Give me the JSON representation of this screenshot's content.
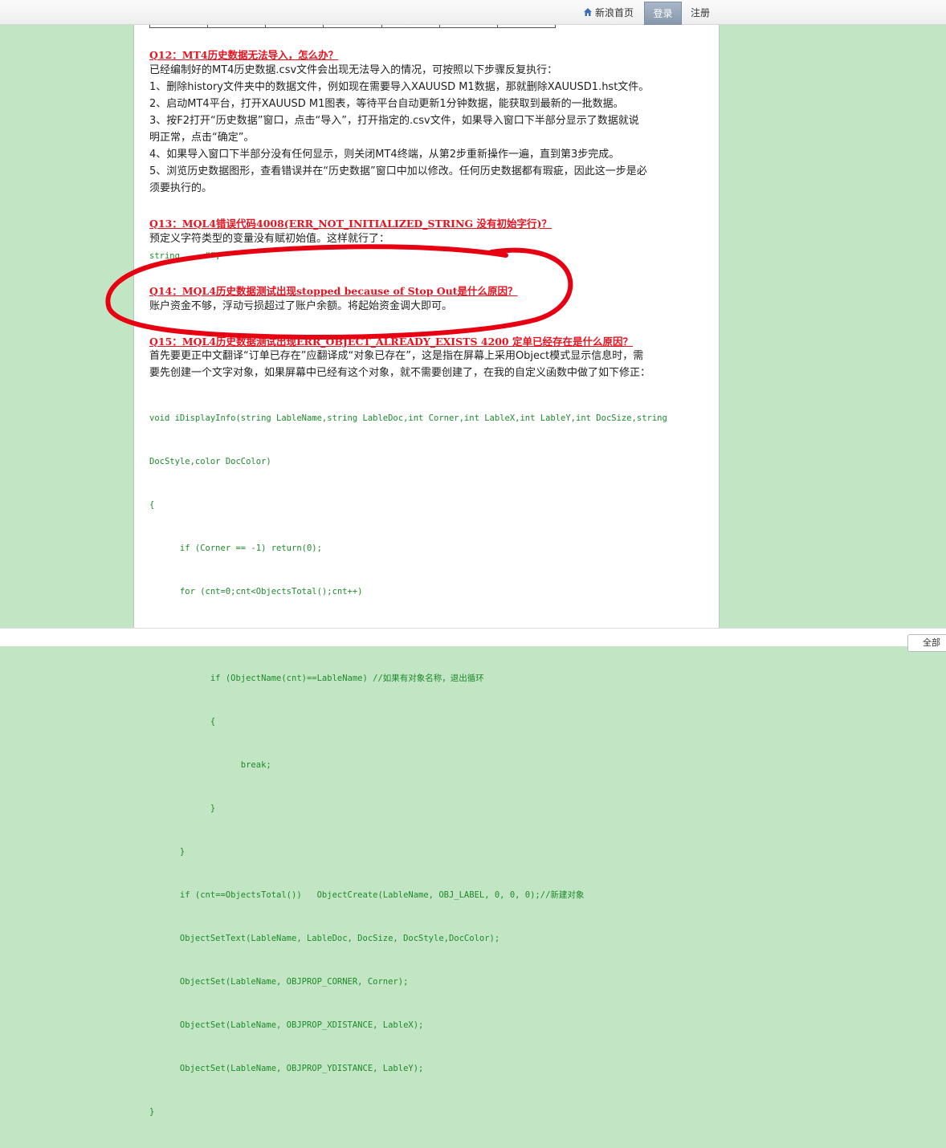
{
  "topbar": {
    "home_label": "新浪首页",
    "login_label": "登录",
    "register_label": "注册"
  },
  "q12": {
    "title": "Q12：MT4历史数据无法导入，怎么办？",
    "lines": [
      "已经编制好的MT4历史数据.csv文件会出现无法导入的情况，可按照以下步骤反复执行：",
      "1、删除history文件夹中的数据文件，例如现在需要导入XAUUSD M1数据，那就删除XAUUSD1.hst文件。",
      "2、启动MT4平台，打开XAUUSD M1图表，等待平台自动更新1分钟数据，能获取到最新的一批数据。",
      "3、按F2打开“历史数据”窗口，点击“导入”，打开指定的.csv文件，如果导入窗口下半部分显示了数据就说",
      "明正常，点击“确定”。",
      "4、如果导入窗口下半部分没有任何显示，则关闭MT4终端，从第2步重新操作一遍，直到第3步完成。",
      "5、浏览历史数据图形，查看错误并在“历史数据”窗口中加以修改。任何历史数据都有瑕疵，因此这一步是必",
      "须要执行的。"
    ]
  },
  "q13": {
    "title": "Q13：MQL4错误代码4008(ERR_NOT_INITIALIZED_STRING 没有初始字行)？",
    "line": "预定义字符类型的变量没有赋初始值。这样就行了：",
    "code": "string   ……“”;"
  },
  "q14": {
    "title": "Q14：MQL4历史数据测试出现stopped because of Stop Out是什么原因？",
    "line": "账户资金不够，浮动亏损超过了账户余额。将起始资金调大即可。"
  },
  "q15": {
    "title": "Q15：MQL4历史数据测试出现ERR_OBJECT_ALREADY_EXISTS 4200 定单已经存在是什么原因？",
    "lines": [
      "首先要更正中文翻译“订单已存在”应翻译成“对象已存在”，这是指在屏幕上采用Object模式显示信息时，需",
      "要先创建一个文字对象，如果屏幕中已经有这个对象，就不需要创建了，在我的自定义函数中做了如下修正："
    ],
    "code": [
      "void iDisplayInfo(string LableName,string LableDoc,int Corner,int LableX,int LableY,int DocSize,string",
      "DocStyle,color DocColor)",
      "{",
      "      if (Corner == -1) return(0);",
      "      for (cnt=0;cnt<ObjectsTotal();cnt++)",
      "      {",
      "            if (ObjectName(cnt)==LableName) //如果有对象名称，退出循环",
      "            {",
      "                  break;",
      "            }",
      "      }",
      "      if (cnt==ObjectsTotal())   ObjectCreate(LableName, OBJ_LABEL, 0, 0, 0);//新建对象",
      "      ObjectSetText(LableName, LableDoc, DocSize, DocStyle,DocColor);",
      "      ObjectSet(LableName, OBJPROP_CORNER, Corner);",
      "      ObjectSet(LableName, OBJPROP_XDISTANCE, LableX);",
      "      ObjectSet(LableName, OBJPROP_YDISTANCE, LableY);",
      "}"
    ]
  },
  "corner_button": {
    "label": "全部"
  },
  "colors": {
    "background": "#c2e6c4",
    "question_title": "#e8121f",
    "code_text": "#1d8a2a",
    "annotation_circle": "#e60012"
  }
}
